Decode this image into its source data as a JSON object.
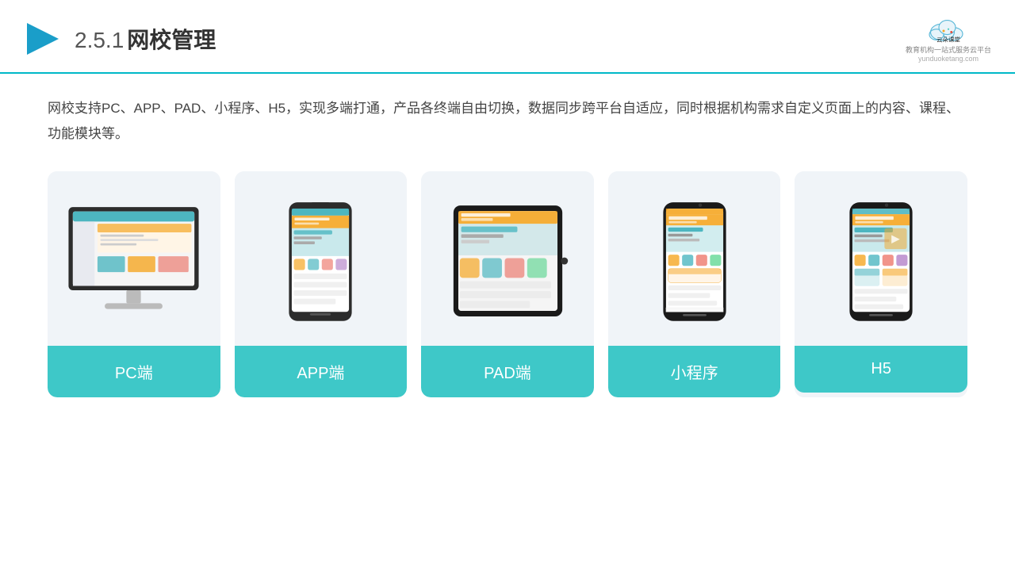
{
  "header": {
    "title_prefix": "2.5.1",
    "title_main": "网校管理",
    "logo_name": "云朵课堂",
    "logo_tagline": "教育机构一站式服务云平台",
    "logo_url": "yunduoketang.com"
  },
  "description": {
    "text": "网校支持PC、APP、PAD、小程序、H5，实现多端打通，产品各终端自由切换，数据同步跨平台自适应，同时根据机构需求自定义页面上的内容、课程、功能模块等。"
  },
  "cards": [
    {
      "id": "pc",
      "label": "PC端"
    },
    {
      "id": "app",
      "label": "APP端"
    },
    {
      "id": "pad",
      "label": "PAD端"
    },
    {
      "id": "miniapp",
      "label": "小程序"
    },
    {
      "id": "h5",
      "label": "H5"
    }
  ]
}
